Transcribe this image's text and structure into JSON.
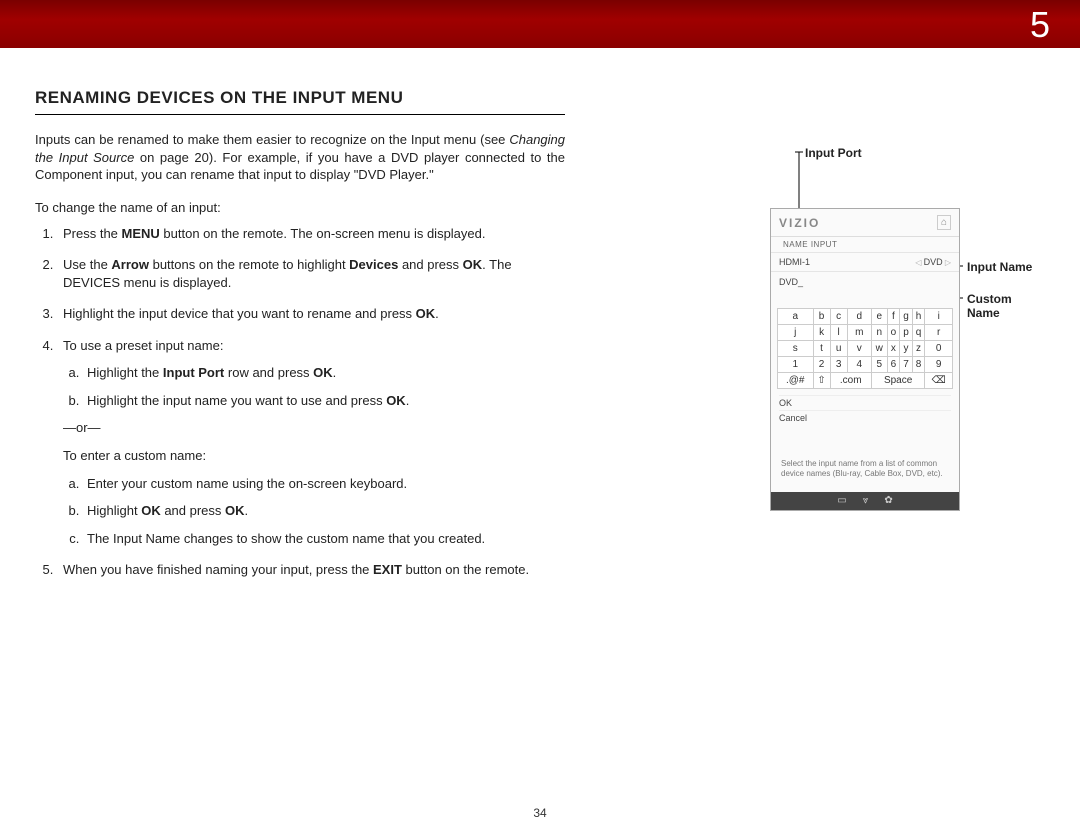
{
  "chapter_number": "5",
  "heading": "RENAMING DEVICES ON THE INPUT MENU",
  "intro_part1": "Inputs can be renamed to make them easier to recognize on the Input menu (see ",
  "intro_italic": "Changing the Input Source",
  "intro_part2": " on page 20). For example, if you have a DVD player connected to the Component input, you can rename that input to display \"DVD Player.\"",
  "lead": "To change the name of an input:",
  "step1_a": "Press the ",
  "step1_bold": "MENU",
  "step1_b": " button on the remote. The on-screen menu is displayed.",
  "step2_a": "Use the ",
  "step2_bold1": "Arrow",
  "step2_b": " buttons on the remote to highlight ",
  "step2_bold2": "Devices",
  "step2_c": " and press ",
  "step2_bold3": "OK",
  "step2_d": ". The DEVICES menu is displayed.",
  "step3_a": "Highlight the input device that you want to rename and press ",
  "step3_bold": "OK",
  "step3_b": ".",
  "step4": "To use a preset input name:",
  "step4a_a": "Highlight the ",
  "step4a_bold1": "Input Port",
  "step4a_b": " row and press ",
  "step4a_bold2": "OK",
  "step4a_c": ".",
  "step4b_a": "Highlight the input name you want to use and press ",
  "step4b_bold": "OK",
  "step4b_b": ".",
  "or_text": "—or—",
  "custom_lead": "To enter a custom name:",
  "step4ca": "Enter your custom name using the on-screen keyboard.",
  "step4cb_a": "Highlight ",
  "step4cb_bold1": "OK",
  "step4cb_b": " and press ",
  "step4cb_bold2": "OK",
  "step4cb_c": ".",
  "step4cc": "The Input Name changes to show the custom name that you created.",
  "step5_a": "When you have finished naming your input, press the ",
  "step5_bold": "EXIT",
  "step5_b": " button on the remote.",
  "label_port": "Input Port",
  "label_iname": "Input Name",
  "label_cname": "Custom Name",
  "tv": {
    "brand": "VIZIO",
    "title": "NAME INPUT",
    "port": "HDMI-1",
    "preset": "DVD",
    "custom": "DVD_",
    "kb_rows": [
      [
        "a",
        "b",
        "c",
        "d",
        "e",
        "f",
        "g",
        "h",
        "i"
      ],
      [
        "j",
        "k",
        "l",
        "m",
        "n",
        "o",
        "p",
        "q",
        "r"
      ],
      [
        "s",
        "t",
        "u",
        "v",
        "w",
        "x",
        "y",
        "z",
        "0"
      ],
      [
        "1",
        "2",
        "3",
        "4",
        "5",
        "6",
        "7",
        "8",
        "9"
      ]
    ],
    "kb_bottom": [
      ".@#",
      "⇧",
      ".com",
      "Space",
      "⌫"
    ],
    "ok": "OK",
    "cancel": "Cancel",
    "help": "Select the input name from a list of common device names (Blu-ray, Cable Box, DVD, etc).",
    "icons": [
      "▭",
      "⩔",
      "✿"
    ]
  },
  "page_number": "34"
}
